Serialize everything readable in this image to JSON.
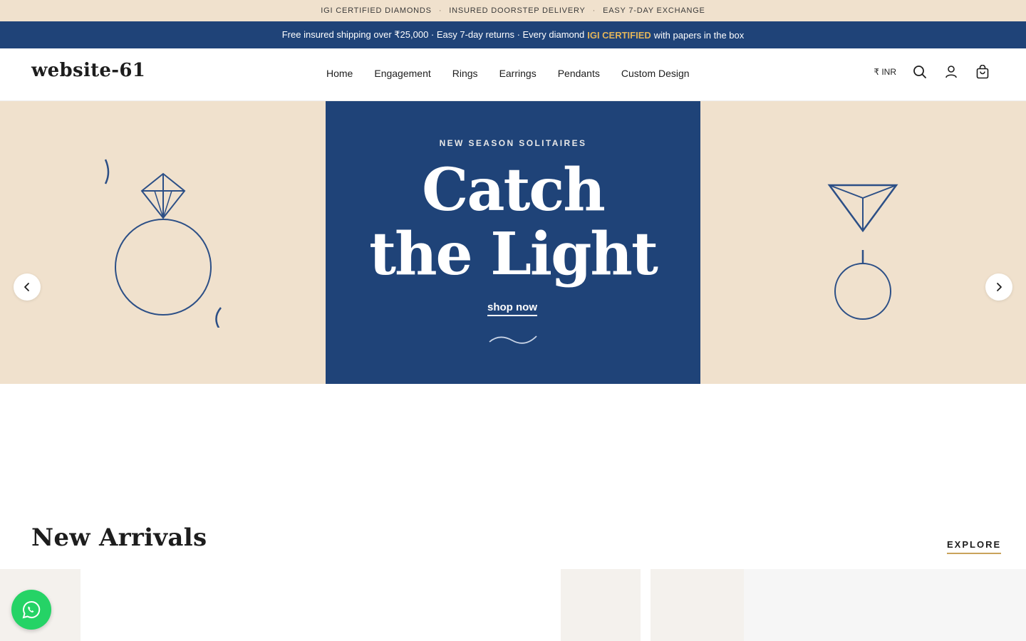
{
  "topbar": {
    "items": [
      "IGI CERTIFIED DIAMONDS",
      "INSURED DOORSTEP DELIVERY",
      "EASY 7-DAY EXCHANGE"
    ],
    "separator": "·"
  },
  "promo": {
    "text_before": "Free insured shipping over ₹25,000 · Easy 7-day returns · Every diamond",
    "highlight": "IGI CERTIFIED",
    "text_after": "with papers in the box"
  },
  "header": {
    "logo": "website-61",
    "nav": [
      "Home",
      "Engagement",
      "Rings",
      "Earrings",
      "Pendants",
      "Custom Design"
    ],
    "currency": "₹ INR",
    "icons": [
      "search-icon",
      "account-icon",
      "cart-icon"
    ]
  },
  "hero": {
    "eyebrow": "NEW SEASON SOLITAIRES",
    "headline_line1": "Catch",
    "headline_line2": "the Light",
    "cta": "shop now",
    "prev_icon": "chevron-left-icon",
    "next_icon": "chevron-right-icon"
  },
  "section": {
    "title": "New Arrivals",
    "explore": "EXPLORE"
  },
  "floating": {
    "icon": "whatsapp-icon"
  },
  "colors": {
    "navy": "#1f4378",
    "cream": "#f0e1cd",
    "gold": "#e2b55a",
    "whatsapp": "#25d366"
  }
}
